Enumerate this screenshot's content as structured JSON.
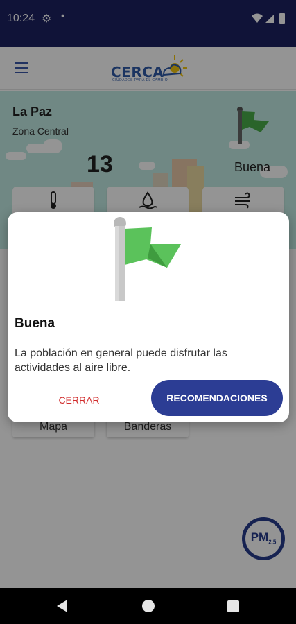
{
  "status_bar": {
    "time": "10:24",
    "settings_icon": "gear-icon",
    "notification_dot": "•",
    "wifi_icon": "wifi-icon",
    "signal_icon": "signal-icon",
    "battery_icon": "battery-icon"
  },
  "app_bar": {
    "menu_icon": "hamburger-icon",
    "logo_text": "CERCA",
    "logo_tagline": "CIUDADES PARA EL CAMBIO"
  },
  "location": {
    "city": "La Paz",
    "zone": "Zona Central",
    "value": "13",
    "quality": "Buena"
  },
  "metrics": [
    {
      "icon": "thermometer-icon"
    },
    {
      "icon": "humidity-icon"
    },
    {
      "icon": "wind-icon"
    }
  ],
  "nav_buttons": {
    "map": "Mapa",
    "flags": "Banderas"
  },
  "fab": {
    "label": "PM",
    "subscript": "2.5"
  },
  "dialog": {
    "title": "Buena",
    "message": "La población en general puede disfrutar las actividades al aire libre.",
    "close_label": "CERRAR",
    "recommendations_label": "RECOMENDACIONES"
  },
  "colors": {
    "status_bar": "#1c2161",
    "flag_green": "#5bc25b",
    "primary_button": "#2c3d94",
    "close_text": "#d12b2b",
    "hero_background": "#c2ebe3"
  }
}
